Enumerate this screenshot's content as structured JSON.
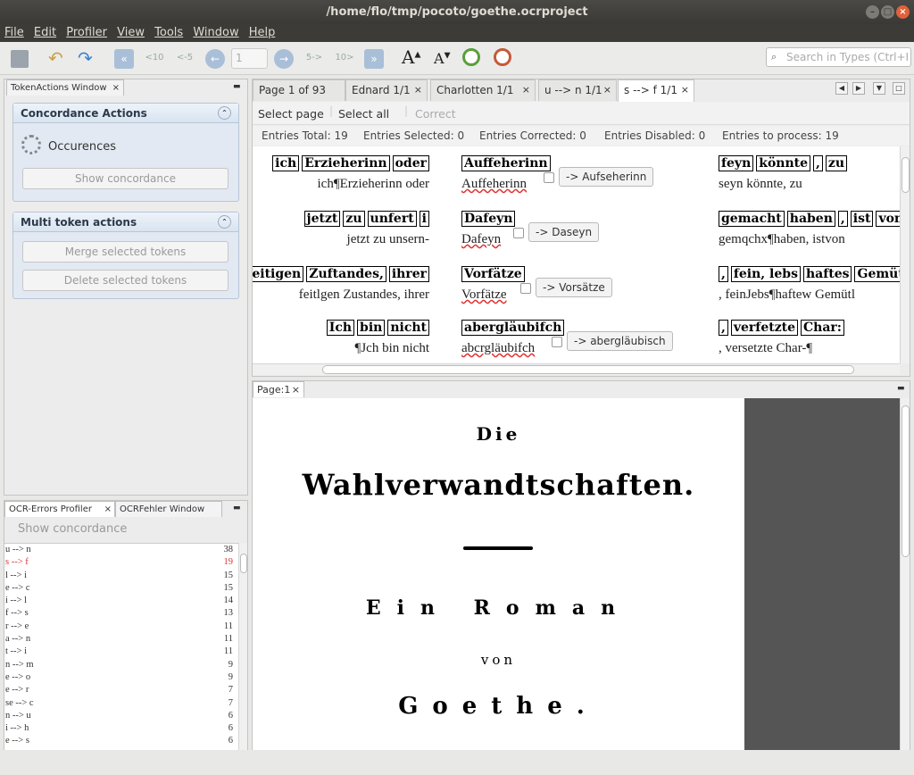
{
  "window": {
    "title": "/home/flo/tmp/pocoto/goethe.ocrproject"
  },
  "menu": [
    "File",
    "Edit",
    "Profiler",
    "View",
    "Tools",
    "Window",
    "Help"
  ],
  "toolbar": {
    "back10": "<10",
    "back5": "<-5",
    "page_input": "1",
    "fwd5": "5->",
    "fwd10": "10>",
    "search_placeholder": "Search in Types (Ctrl+I"
  },
  "left_panel": {
    "tab": "TokenActions Window",
    "concordance": {
      "title": "Concordance Actions",
      "occurences": "Occurences",
      "show": "Show concordance"
    },
    "multi": {
      "title": "Multi token actions",
      "merge": "Merge selected tokens",
      "delete": "Delete selected tokens"
    }
  },
  "profiler": {
    "tabs": [
      "OCR-Errors Profiler",
      "OCRFehler Window"
    ],
    "show": "Show concordance",
    "rows": [
      {
        "pattern": "u --> n",
        "count": "38"
      },
      {
        "pattern": "s --> f",
        "count": "19",
        "selected": true
      },
      {
        "pattern": "l --> i",
        "count": "15"
      },
      {
        "pattern": "e --> c",
        "count": "15"
      },
      {
        "pattern": "i --> l",
        "count": "14"
      },
      {
        "pattern": "f --> s",
        "count": "13"
      },
      {
        "pattern": "r --> e",
        "count": "11"
      },
      {
        "pattern": "a --> n",
        "count": "11"
      },
      {
        "pattern": "t --> i",
        "count": "11"
      },
      {
        "pattern": "n --> m",
        "count": "9"
      },
      {
        "pattern": "e --> o",
        "count": "9"
      },
      {
        "pattern": "e --> r",
        "count": "7"
      },
      {
        "pattern": "se --> c",
        "count": "7"
      },
      {
        "pattern": "n --> u",
        "count": "6"
      },
      {
        "pattern": "i --> h",
        "count": "6"
      },
      {
        "pattern": "e --> s",
        "count": "6"
      }
    ]
  },
  "doc_tabs": [
    "Page 1 of 93",
    "Ednard 1/1",
    "Charlotten 1/1",
    "u --> n 1/1",
    "s --> f 1/1"
  ],
  "concordance": {
    "actions": {
      "select_page": "Select page",
      "select_all": "Select all",
      "correct": "Correct"
    },
    "stats": {
      "total": "Entries Total: 19",
      "selected": "Entries Selected: 0",
      "corrected": "Entries Corrected: 0",
      "disabled": "Entries Disabled: 0",
      "to_process": "Entries to process: 19"
    },
    "rows": [
      {
        "left_img": [
          "ich",
          "Erzieherinn",
          "oder"
        ],
        "left_ocr": "ich¶Erzieherinn oder",
        "mid_img": "Auffeherinn",
        "mid_ocr": "Auffeherinn",
        "btn": "-> Aufseherinn",
        "right_img": [
          "feyn",
          "könnte",
          ",",
          "zu"
        ],
        "right_ocr": "seyn könnte,  zu"
      },
      {
        "left_img": [
          "jetzt",
          "zu",
          "unfert",
          "i"
        ],
        "left_ocr": "jetzt zu unsern-",
        "mid_img": "Dafeyn",
        "mid_ocr": "Dafeyn",
        "btn": "-> Daseyn",
        "right_img": [
          "gemacht",
          "haben",
          ",",
          "ist",
          "von"
        ],
        "right_ocr": "gemqchx¶haben,  istvon"
      },
      {
        "left_img": [
          "feitigen",
          "Zuftandes,",
          "ihrer"
        ],
        "left_ocr": "feitlgen Zustandes,  ihrer",
        "mid_img": "Vorfätze",
        "mid_ocr": "Vorfätze",
        "btn": "-> Vorsätze",
        "right_img": [
          ",",
          "fein, lebs",
          "haftes",
          "Gemüt"
        ],
        "right_ocr": ",  feinJebs¶haftew Gemütl"
      },
      {
        "left_img": [
          "Ich",
          "bin",
          "nicht"
        ],
        "left_ocr": "¶Jch bin nicht",
        "mid_img": "abergläubifch",
        "mid_ocr": "abcrgläubifch",
        "btn": "-> abergläubisch",
        "right_img": [
          ",",
          "verfetzte",
          "Char:"
        ],
        "right_ocr": ",  versetzte  Char-¶"
      }
    ]
  },
  "page_view": {
    "tab": "Page:1",
    "lines": [
      "Die",
      "Wahlverwandtschaften.",
      "Ein  Roman",
      "von",
      "Goethe."
    ]
  }
}
